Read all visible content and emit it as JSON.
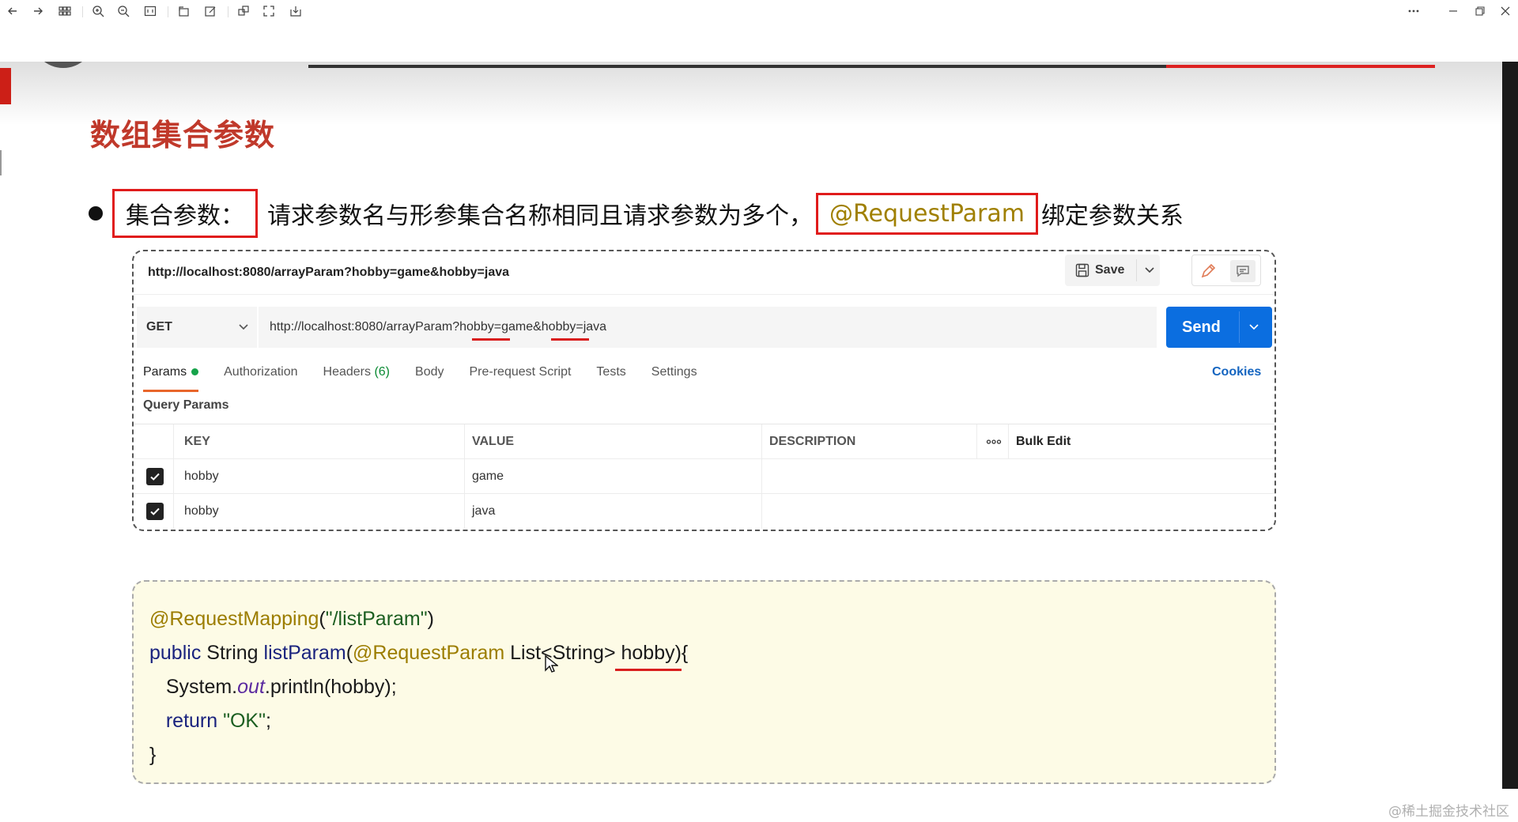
{
  "slide": {
    "title": "数组集合参数",
    "bullet": {
      "term": "集合参数：",
      "text": "请求参数名与形参集合名称相同且请求参数为多个，",
      "annotation": "@RequestParam",
      "suffix": "绑定参数关系"
    }
  },
  "postman": {
    "title_url": "http://localhost:8080/arrayParam?hobby=game&hobby=java",
    "save_label": "Save",
    "method": "GET",
    "request_url": "http://localhost:8080/arrayParam?hobby=game&hobby=java",
    "send_label": "Send",
    "tabs": {
      "params": "Params",
      "authorization": "Authorization",
      "headers": "Headers",
      "headers_count": "(6)",
      "body": "Body",
      "pre_request": "Pre-request Script",
      "tests": "Tests",
      "settings": "Settings"
    },
    "cookies_label": "Cookies",
    "query_params_label": "Query Params",
    "columns": {
      "key": "KEY",
      "value": "VALUE",
      "description": "DESCRIPTION",
      "bulk_edit": "Bulk Edit"
    },
    "rows": [
      {
        "key": "hobby",
        "value": "game",
        "description": ""
      },
      {
        "key": "hobby",
        "value": "java",
        "description": ""
      }
    ]
  },
  "code": {
    "l1_anno": "@RequestMapping",
    "l1_paren_open": "(",
    "l1_str": "\"/listParam\"",
    "l1_paren_close": ")",
    "l2_public": "public",
    "l2_type": " String ",
    "l2_fn": "listParam",
    "l2_open": "(",
    "l2_anno": "@RequestParam",
    "l2_rest": " List<String> hobby){",
    "l3_indent": "   System.",
    "l3_out": "out",
    "l3_rest": ".println(hobby);",
    "l4_indent": "   ",
    "l4_return": "return",
    "l4_space": " ",
    "l4_str": "\"OK\"",
    "l4_semi": ";",
    "l5": "}"
  },
  "watermark": "@稀土掘金技术社区",
  "colors": {
    "title_red": "#c0392b",
    "box_red": "#e01b1b",
    "send_blue": "#0b6ee0",
    "tab_orange": "#e8662b",
    "annotation_gold": "#9c7d00"
  }
}
